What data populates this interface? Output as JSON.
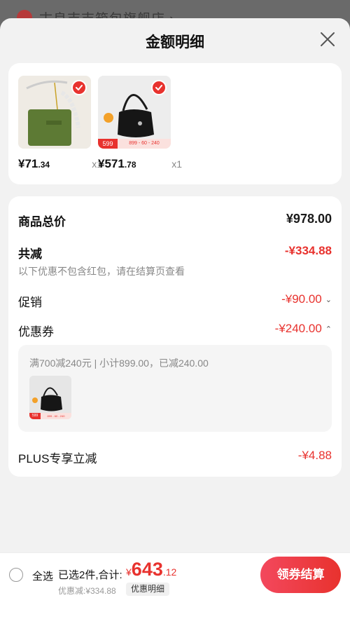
{
  "background": {
    "store_name": "古良吉吉箱包旗舰店 ›"
  },
  "sheet": {
    "title": "金额明细",
    "close_icon": "close-icon"
  },
  "products": [
    {
      "name_icon": "green-handbag-image",
      "price_int": "¥71",
      "price_cents": ".34",
      "qty": "x1",
      "selected": true
    },
    {
      "name_icon": "black-shoulder-bag-image",
      "price_int": "¥571",
      "price_cents": ".78",
      "qty": "x1",
      "selected": true,
      "promo_price": "599",
      "promo_detail": "899 - 60 - 240"
    }
  ],
  "details": {
    "total_label": "商品总价",
    "total_value": "¥978.00",
    "reduce_label": "共减",
    "reduce_value": "-¥334.88",
    "reduce_note": "以下优惠不包含红包，请在结算页查看",
    "promo_label": "促销",
    "promo_value": "-¥90.00",
    "coupon_label": "优惠券",
    "coupon_value": "-¥240.00",
    "coupon_detail": "满700减240元 | 小计899.00，已减240.00",
    "coupon_thumb_promo_price": "599",
    "coupon_thumb_promo_detail": "899 - 60 - 240",
    "plus_label": "PLUS专享立减",
    "plus_value": "-¥4.88"
  },
  "bottom_bar": {
    "select_all": "全选",
    "selected_count": "已选2件,合计:",
    "total_currency": "¥",
    "total_int": "643",
    "total_cents": ".12",
    "discount_line": "优惠减:¥334.88",
    "detail_chip": "优惠明细",
    "checkout": "领券结算"
  },
  "colors": {
    "accent": "#e8322e",
    "background": "#f2f2f2"
  }
}
